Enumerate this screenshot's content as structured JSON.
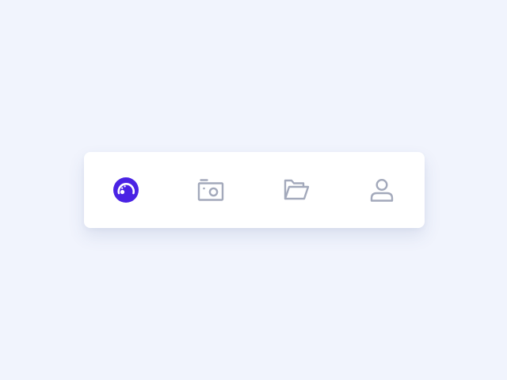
{
  "colors": {
    "background": "#f1f4fd",
    "bar": "#ffffff",
    "active": "#4a23e4",
    "inactive": "#a3a9bb"
  },
  "tabbar": {
    "active_index": 0,
    "tabs": [
      {
        "icon": "dashboard-gauge-icon",
        "active": true
      },
      {
        "icon": "camera-icon",
        "active": false
      },
      {
        "icon": "folder-open-icon",
        "active": false
      },
      {
        "icon": "user-icon",
        "active": false
      }
    ]
  }
}
